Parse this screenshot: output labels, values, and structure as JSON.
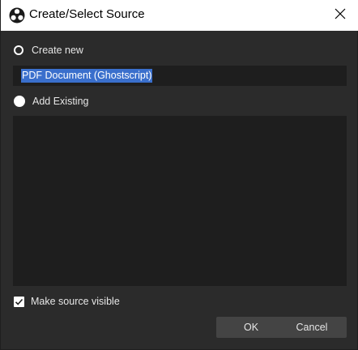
{
  "window": {
    "title": "Create/Select Source",
    "app_icon": "obs-logo-icon",
    "close_icon": "close-icon"
  },
  "create_new": {
    "label": "Create new",
    "selected": false,
    "name_value": "PDF Document (Ghostscript)"
  },
  "add_existing": {
    "label": "Add Existing",
    "selected": true,
    "items": []
  },
  "options": {
    "make_visible_label": "Make source visible",
    "make_visible_checked": true
  },
  "buttons": {
    "ok_label": "OK",
    "cancel_label": "Cancel"
  },
  "colors": {
    "background": "#2b2b2b",
    "field": "#1e1e1e",
    "selection": "#3a6fcc",
    "button": "#444444"
  }
}
